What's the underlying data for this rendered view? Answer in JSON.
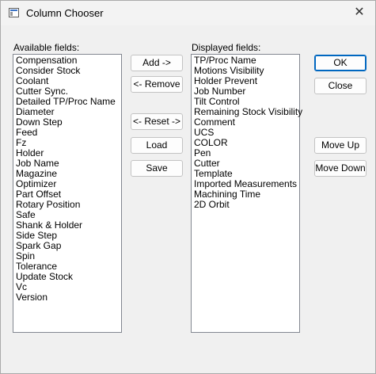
{
  "window": {
    "title": "Column Chooser",
    "close_glyph": "✕"
  },
  "available": {
    "label": "Available fields:",
    "items": [
      "Compensation",
      "Consider Stock",
      "Coolant",
      "Cutter Sync.",
      "Detailed TP/Proc Name",
      "Diameter",
      "Down Step",
      "Feed",
      "Fz",
      "Holder",
      "Job Name",
      "Magazine",
      "Optimizer",
      "Part Offset",
      "Rotary Position",
      "Safe",
      "Shank & Holder",
      "Side Step",
      "Spark Gap",
      "Spin",
      "Tolerance",
      "Update Stock",
      "Vc",
      "Version"
    ]
  },
  "displayed": {
    "label": "Displayed fields:",
    "items": [
      "TP/Proc Name",
      "Motions Visibility",
      "Holder Prevent",
      "Job  Number",
      "Tilt Control",
      "Remaining Stock Visibility",
      "Comment",
      "UCS",
      "COLOR",
      "Pen",
      "Cutter",
      "Template",
      "Imported Measurements",
      "Machining Time",
      "2D Orbit"
    ]
  },
  "buttons": {
    "add": "Add ->",
    "remove": "<- Remove",
    "reset": "<- Reset ->",
    "load": "Load",
    "save": "Save",
    "ok": "OK",
    "close": "Close",
    "move_up": "Move Up",
    "move_down": "Move Down"
  }
}
